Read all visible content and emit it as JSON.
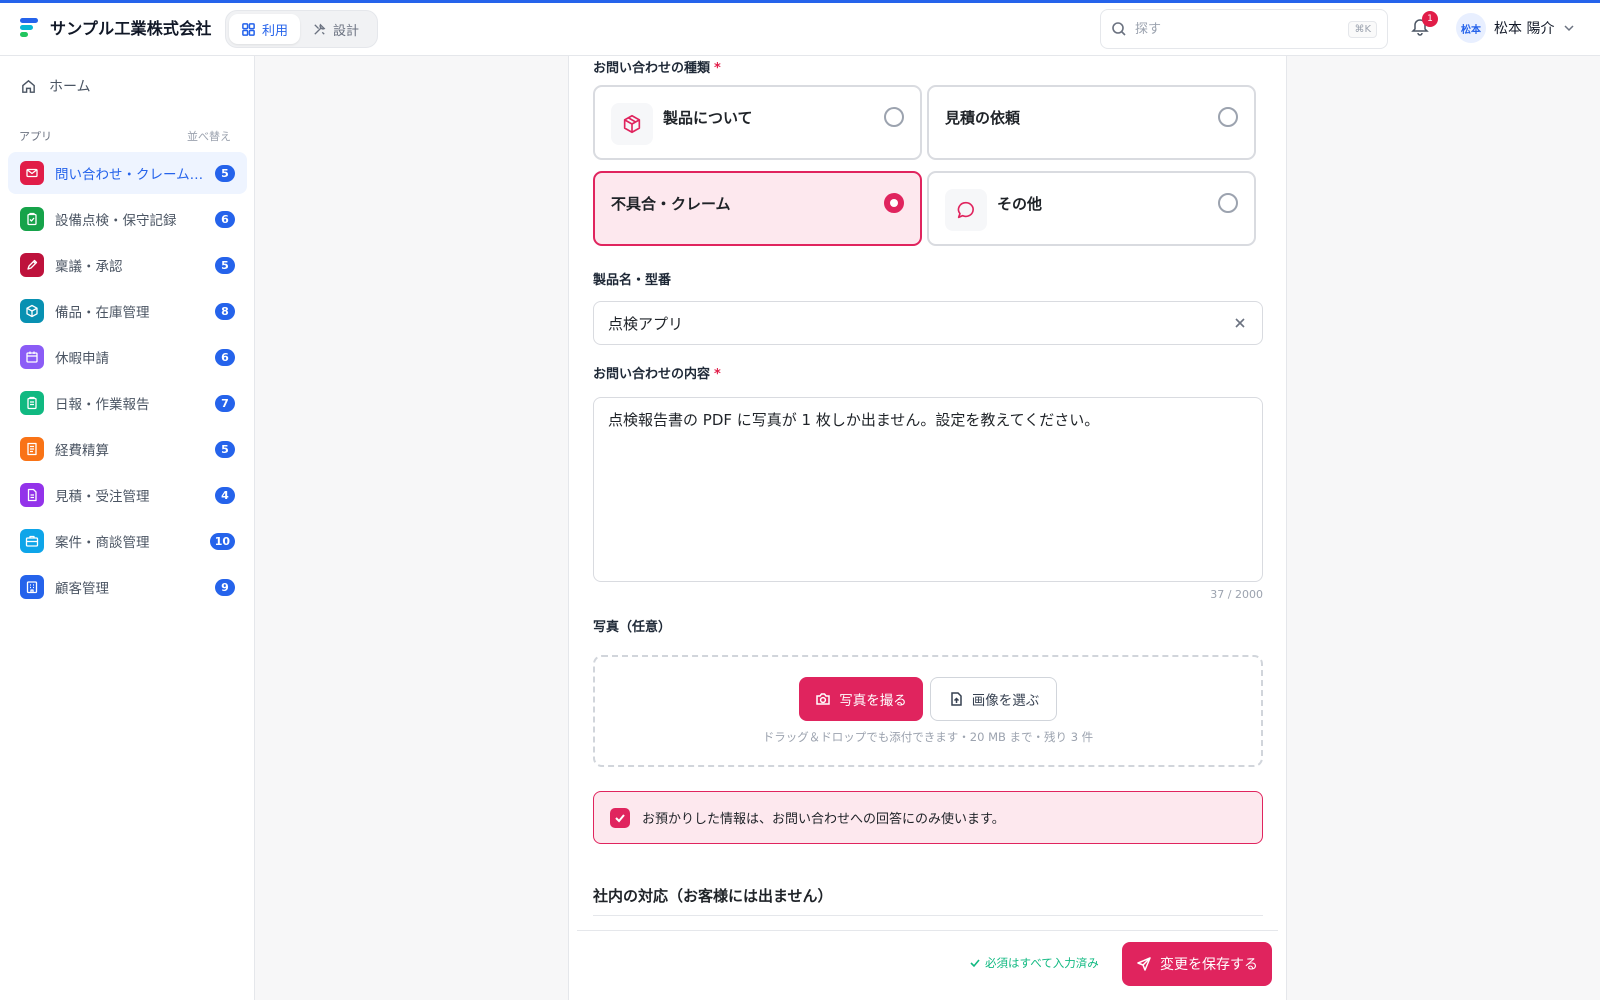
{
  "header": {
    "company": "サンプル工業株式会社",
    "modes": [
      {
        "label": "利用",
        "icon": "grid-icon",
        "active": true
      },
      {
        "label": "設計",
        "icon": "tools-icon",
        "active": false
      }
    ],
    "search": {
      "placeholder": "探す",
      "shortcut": "⌘K"
    },
    "notifications": {
      "count": "1"
    },
    "user": {
      "initials": "松本",
      "name": "松本 陽介"
    },
    "accent": "#2563eb"
  },
  "sidebar": {
    "home_label": "ホーム",
    "section_label": "アプリ",
    "sort_label": "並べ替え",
    "items": [
      {
        "label": "問い合わせ・クレーム管理",
        "count": "5",
        "icon": "mail-icon",
        "color": "#e11d48",
        "active": true
      },
      {
        "label": "設備点検・保守記録",
        "count": "6",
        "icon": "clipboard-check-icon",
        "color": "#16a34a",
        "active": false
      },
      {
        "label": "稟議・承認",
        "count": "5",
        "icon": "pen-icon",
        "color": "#be123c",
        "active": false
      },
      {
        "label": "備品・在庫管理",
        "count": "8",
        "icon": "box-icon",
        "color": "#0891b2",
        "active": false
      },
      {
        "label": "休暇申請",
        "count": "6",
        "icon": "calendar-icon",
        "color": "#8b5cf6",
        "active": false
      },
      {
        "label": "日報・作業報告",
        "count": "7",
        "icon": "clipboard-icon",
        "color": "#10b981",
        "active": false
      },
      {
        "label": "経費精算",
        "count": "5",
        "icon": "receipt-icon",
        "color": "#f97316",
        "active": false
      },
      {
        "label": "見積・受注管理",
        "count": "4",
        "icon": "document-icon",
        "color": "#9333ea",
        "active": false
      },
      {
        "label": "案件・商談管理",
        "count": "10",
        "icon": "briefcase-icon",
        "color": "#0ea5e9",
        "active": false
      },
      {
        "label": "顧客管理",
        "count": "9",
        "icon": "building-icon",
        "color": "#2563eb",
        "active": false
      }
    ]
  },
  "form": {
    "type_label": "お問い合わせの種類",
    "required_mark": "*",
    "type_options": [
      {
        "label": "製品について",
        "icon": "box-icon",
        "selected": false
      },
      {
        "label": "見積の依頼",
        "icon": "",
        "selected": false
      },
      {
        "label": "不具合・クレーム",
        "icon": "",
        "selected": true
      },
      {
        "label": "その他",
        "icon": "chat-icon",
        "selected": false
      }
    ],
    "product_label": "製品名・型番",
    "product_value": "点検アプリ",
    "content_label": "お問い合わせの内容",
    "content_value": "点検報告書の PDF に写真が 1 枚しか出ません。設定を教えてください。",
    "char_count": "37 / 2000",
    "photo_label": "写真（任意）",
    "camera_button": "写真を撮る",
    "image_button": "画像を選ぶ",
    "dropzone_hint": "ドラッグ＆ドロップでも添付できます・20 MB まで・残り 3 件",
    "consent_text": "お預かりした情報は、お問い合わせへの回答にのみ使います。",
    "consent_checked": true,
    "internal_section_title": "社内の対応（お客様には出ません）",
    "status_text": "必須はすべて入力済み",
    "save_button": "変更を保存する",
    "accent": "#e0245e"
  }
}
